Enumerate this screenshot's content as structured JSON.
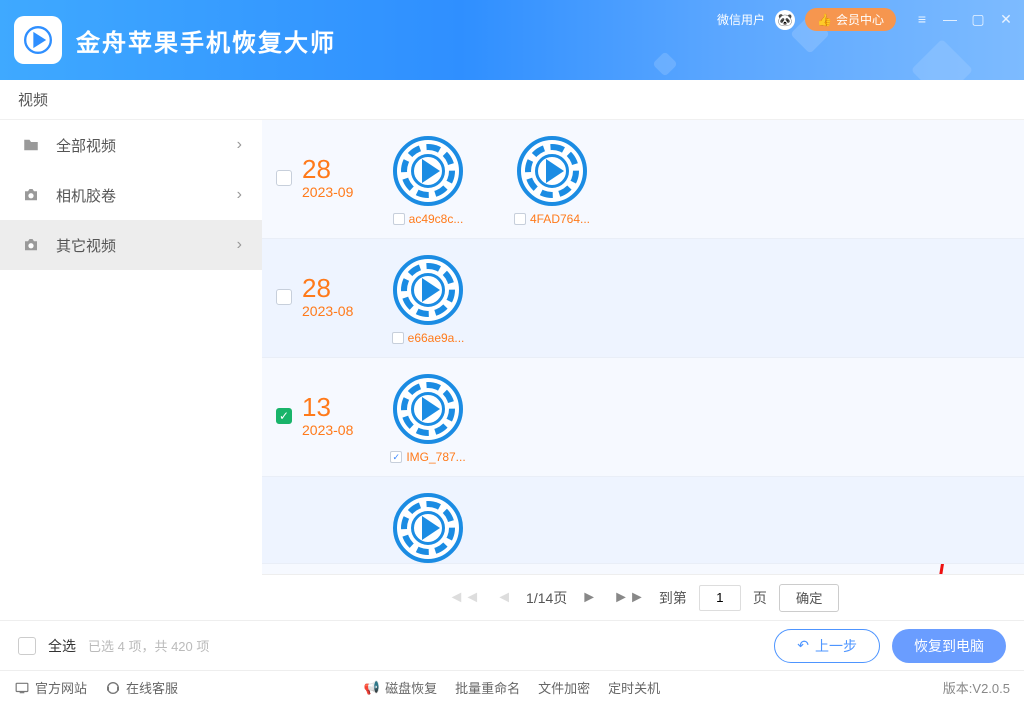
{
  "header": {
    "app_title": "金舟苹果手机恢复大师",
    "user_label": "微信用户",
    "member_label": "会员中心"
  },
  "sub_header_title": "视频",
  "sidebar": {
    "items": [
      {
        "label": "全部视频",
        "icon": "folder"
      },
      {
        "label": "相机胶卷",
        "icon": "camera"
      },
      {
        "label": "其它视频",
        "icon": "camera",
        "active": true
      }
    ]
  },
  "groups": [
    {
      "day": "28",
      "ym": "2023-09",
      "checked": false,
      "zebra": false,
      "items": [
        {
          "name": "ac49c8c...",
          "checked": false
        },
        {
          "name": "4FAD764...",
          "checked": false
        }
      ]
    },
    {
      "day": "28",
      "ym": "2023-08",
      "checked": false,
      "zebra": true,
      "items": [
        {
          "name": "e66ae9a...",
          "checked": false
        }
      ]
    },
    {
      "day": "13",
      "ym": "2023-08",
      "checked": true,
      "zebra": false,
      "highlight": true,
      "items": [
        {
          "name": "IMG_787...",
          "checked": true
        }
      ]
    },
    {
      "day": "",
      "ym": "",
      "checked": false,
      "zebra": true,
      "partial": true,
      "items": [
        {
          "name": "",
          "checked": false
        }
      ]
    }
  ],
  "paginator": {
    "page_label": "1/14页",
    "goto_label": "到第",
    "page_unit": "页",
    "page_input": "1",
    "confirm": "确定"
  },
  "selection": {
    "select_all": "全选",
    "info": "已选 4 项，共 420 项",
    "prev_step": "上一步",
    "recover": "恢复到电脑"
  },
  "status": {
    "official_site": "官方网站",
    "online_service": "在线客服",
    "disk_recover": "磁盘恢复",
    "batch_rename": "批量重命名",
    "file_encrypt": "文件加密",
    "timed_shutdown": "定时关机",
    "version": "版本:V2.0.5"
  }
}
